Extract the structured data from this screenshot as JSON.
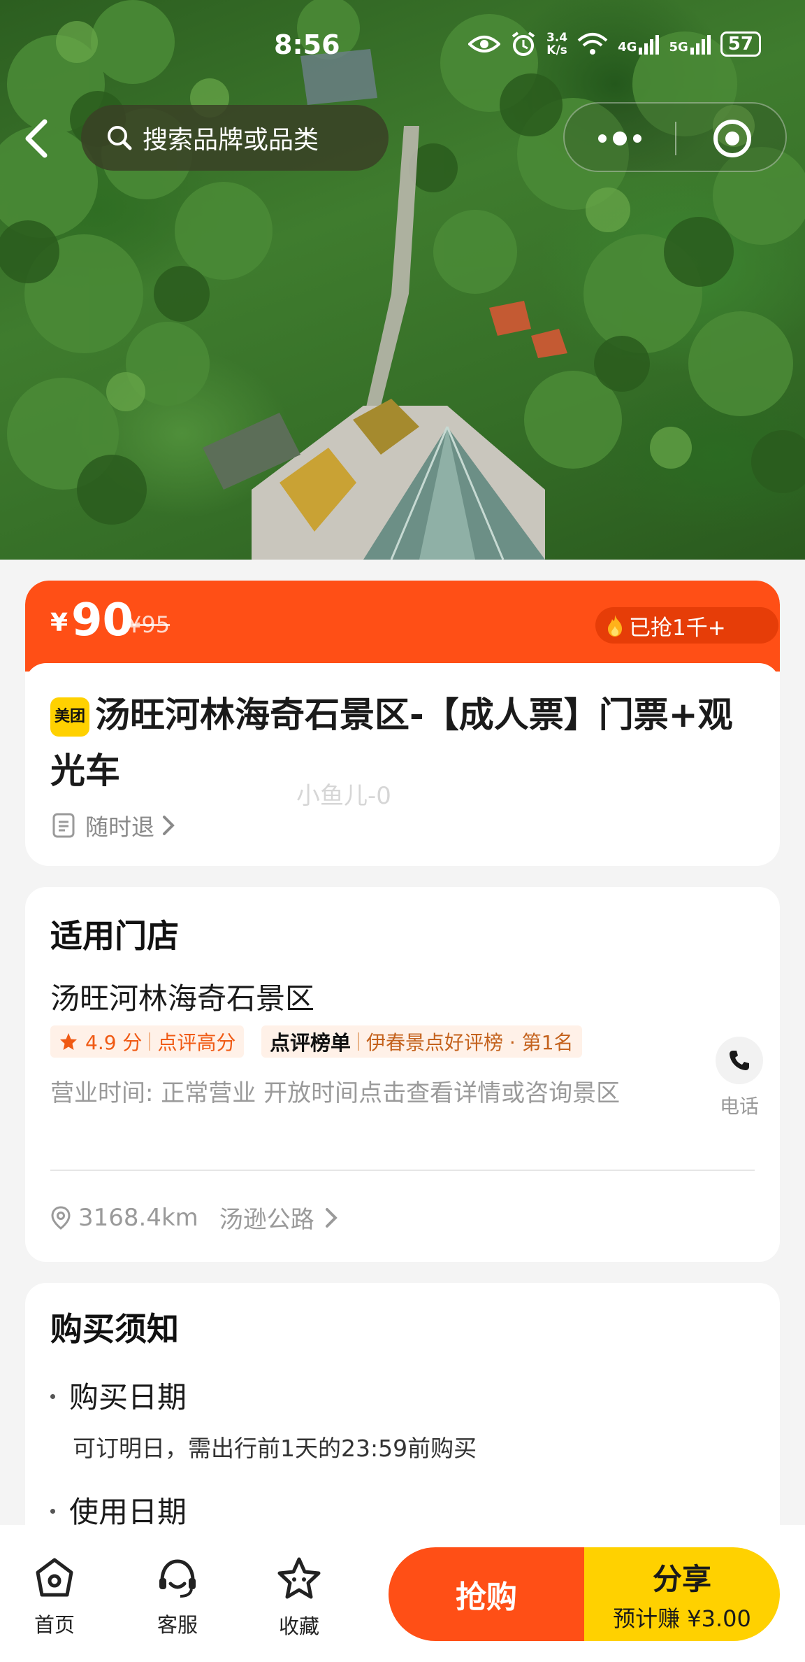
{
  "status_bar": {
    "time": "8:56",
    "net_speed_value": "3.4",
    "net_speed_unit": "K/s",
    "net_4g": "4G",
    "net_5g": "5G",
    "battery": "57"
  },
  "top_nav": {
    "search_placeholder": "搜索品牌或品类"
  },
  "price": {
    "symbol": "¥",
    "current": "90",
    "original": "¥95",
    "sold_label": "已抢1千+"
  },
  "product": {
    "badge": "美团",
    "title": "汤旺河林海奇石景区-【成人票】门票+观光车",
    "refund_policy": "随时退"
  },
  "watermark": "小鱼儿-0",
  "store": {
    "section_title": "适用门店",
    "name": "汤旺河林海奇石景区",
    "rating": "4.9 分",
    "rating_tag": "点评高分",
    "rank_brand": "点评榜单",
    "rank_text": "伊春景点好评榜 · 第1名",
    "hours": "营业时间:  正常营业 开放时间点击查看详情或咨询景区",
    "phone_label": "电话",
    "distance": "3168.4km",
    "address": "汤逊公路"
  },
  "notice": {
    "section_title": "购买须知",
    "items": [
      {
        "label": "购买日期",
        "desc": "可订明日，需出行前1天的23:59前购买"
      },
      {
        "label": "使用日期",
        "desc": ""
      }
    ]
  },
  "bottom_bar": {
    "home": "首页",
    "service": "客服",
    "favorite": "收藏",
    "buy": "抢购",
    "share": "分享",
    "share_earn": "预计赚 ¥3.00"
  },
  "colors": {
    "accent_orange": "#ff4f16",
    "accent_yellow": "#ffd100"
  }
}
